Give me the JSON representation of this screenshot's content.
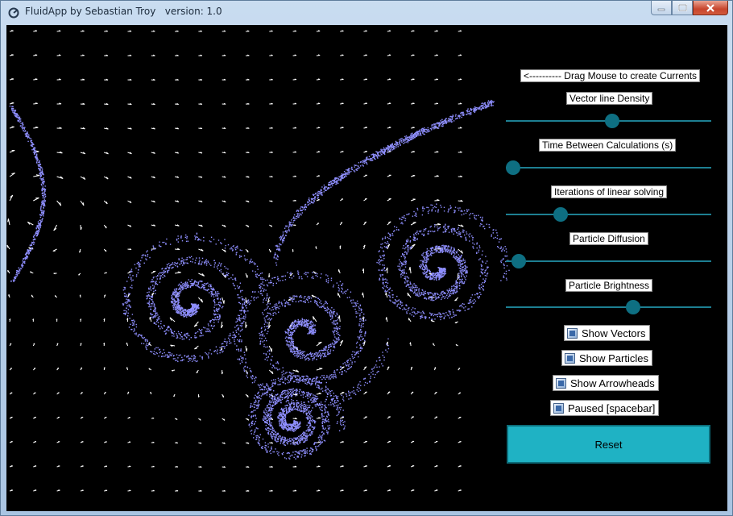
{
  "window": {
    "title": "FluidApp by Sebastian Troy   version: 1.0",
    "buttons": {
      "minimize": "minimize-icon",
      "maximize": "maximize-icon",
      "close": "close-icon"
    }
  },
  "panel": {
    "hint": "<---------- Drag Mouse to create Currents",
    "sliders": [
      {
        "label": "Vector line Density",
        "level_percent": 52
      },
      {
        "label": "Time Between Calculations (s)",
        "level_percent": 0
      },
      {
        "label": "Iterations of linear solving",
        "level_percent": 25
      },
      {
        "label": "Particle Diffusion",
        "level_percent": 3
      },
      {
        "label": "Particle Brightness",
        "level_percent": 63
      }
    ],
    "checkboxes": [
      {
        "label": "Show Vectors",
        "checked": true
      },
      {
        "label": "Show Particles",
        "checked": true
      },
      {
        "label": "Show Arrowheads",
        "checked": true
      },
      {
        "label": "Paused [spacebar]",
        "checked": true
      }
    ],
    "reset_label": "Reset"
  },
  "colors": {
    "background": "#000000",
    "particles": "#8f8fff",
    "vectors": "#ffffff",
    "slider_track": "#1d7f92",
    "reset_button": "#1fb2c4"
  }
}
